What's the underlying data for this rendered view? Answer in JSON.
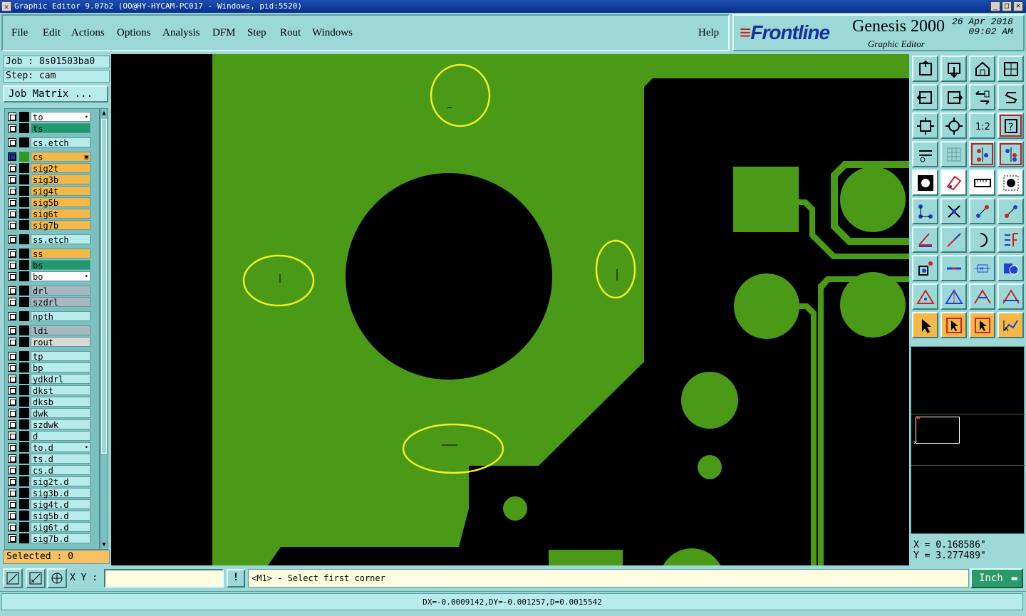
{
  "window": {
    "title": "Graphic Editor 9.07b2 (OO@HY-HYCAM-PC017 - Windows, pid:5520)"
  },
  "menu": {
    "items": [
      "File",
      "Edit",
      "Actions",
      "Options",
      "Analysis",
      "DFM",
      "Step",
      "Rout",
      "Windows"
    ],
    "help": "Help"
  },
  "brand": {
    "logo": "Frontline",
    "product": "Genesis 2000",
    "date_line1": "26 Apr 2018",
    "date_line2": "09:02 AM",
    "subtitle": "Graphic Editor"
  },
  "job": {
    "job_text": "Job : 8s01503ba0",
    "step_text": "Step: cam",
    "matrix_button": "Job Matrix ..."
  },
  "layers": [
    {
      "name": "to",
      "color": "#ffffff",
      "swatch": "#000000",
      "mark": "•"
    },
    {
      "name": "ts",
      "color": "#1f9a6c",
      "swatch": "#000000",
      "mark": ""
    },
    {
      "name": "cs.etch",
      "color": "#b8ecec",
      "swatch": "#000000",
      "mark": ""
    },
    {
      "name": "cs",
      "color": "#f4b848",
      "swatch": "#2e9a1e",
      "mark": "▣",
      "active": true
    },
    {
      "name": "sig2t",
      "color": "#f4b848",
      "swatch": "#000000",
      "mark": ""
    },
    {
      "name": "sig3b",
      "color": "#f4b848",
      "swatch": "#000000",
      "mark": ""
    },
    {
      "name": "sig4t",
      "color": "#f4b848",
      "swatch": "#000000",
      "mark": ""
    },
    {
      "name": "sig5b",
      "color": "#f4b848",
      "swatch": "#000000",
      "mark": ""
    },
    {
      "name": "sig6t",
      "color": "#f4b848",
      "swatch": "#000000",
      "mark": ""
    },
    {
      "name": "sig7b",
      "color": "#f4b848",
      "swatch": "#000000",
      "mark": ""
    },
    {
      "name": "ss.etch",
      "color": "#b8ecec",
      "swatch": "#000000",
      "mark": ""
    },
    {
      "name": "ss",
      "color": "#f4b848",
      "swatch": "#000000",
      "mark": ""
    },
    {
      "name": "bs",
      "color": "#1f9a6c",
      "swatch": "#000000",
      "mark": ""
    },
    {
      "name": "bo",
      "color": "#ffffff",
      "swatch": "#000000",
      "mark": "•"
    },
    {
      "name": "drl",
      "color": "#a8b8c0",
      "swatch": "#000000",
      "mark": ""
    },
    {
      "name": "szdrl",
      "color": "#a8b8c0",
      "swatch": "#000000",
      "mark": ""
    },
    {
      "name": "npth",
      "color": "#b8ecec",
      "swatch": "#000000",
      "mark": ""
    },
    {
      "name": "ldi",
      "color": "#a8b8c0",
      "swatch": "#000000",
      "mark": ""
    },
    {
      "name": "rout",
      "color": "#d8d8d8",
      "swatch": "#000000",
      "mark": ""
    },
    {
      "name": "tp",
      "color": "#b8ecec",
      "swatch": "#000000",
      "mark": ""
    },
    {
      "name": "bp",
      "color": "#b8ecec",
      "swatch": "#000000",
      "mark": ""
    },
    {
      "name": "ydkdrl",
      "color": "#b8ecec",
      "swatch": "#000000",
      "mark": ""
    },
    {
      "name": "dkst",
      "color": "#b8ecec",
      "swatch": "#000000",
      "mark": ""
    },
    {
      "name": "dksb",
      "color": "#b8ecec",
      "swatch": "#000000",
      "mark": ""
    },
    {
      "name": "dwk",
      "color": "#b8ecec",
      "swatch": "#000000",
      "mark": ""
    },
    {
      "name": "szdwk",
      "color": "#b8ecec",
      "swatch": "#000000",
      "mark": ""
    },
    {
      "name": "d",
      "color": "#b8ecec",
      "swatch": "#000000",
      "mark": ""
    },
    {
      "name": "to.d",
      "color": "#b8ecec",
      "swatch": "#000000",
      "mark": "•"
    },
    {
      "name": "ts.d",
      "color": "#b8ecec",
      "swatch": "#000000",
      "mark": ""
    },
    {
      "name": "cs.d",
      "color": "#b8ecec",
      "swatch": "#000000",
      "mark": ""
    },
    {
      "name": "sig2t.d",
      "color": "#b8ecec",
      "swatch": "#000000",
      "mark": ""
    },
    {
      "name": "sig3b.d",
      "color": "#b8ecec",
      "swatch": "#000000",
      "mark": ""
    },
    {
      "name": "sig4t.d",
      "color": "#b8ecec",
      "swatch": "#000000",
      "mark": ""
    },
    {
      "name": "sig5b.d",
      "color": "#b8ecec",
      "swatch": "#000000",
      "mark": ""
    },
    {
      "name": "sig6t.d",
      "color": "#b8ecec",
      "swatch": "#000000",
      "mark": ""
    },
    {
      "name": "sig7b.d",
      "color": "#b8ecec",
      "swatch": "#000000",
      "mark": ""
    }
  ],
  "selected": {
    "text": "Selected : 0"
  },
  "coords": {
    "x": "X = 0.168586\"",
    "y": "Y = 3.277489\""
  },
  "command": {
    "xy_label": "X Y :",
    "xy_value": "",
    "excl": "!",
    "prompt": "<M1> - Select first corner",
    "unit": "Inch"
  },
  "status": {
    "text": "DX=-0.0009142,DY=-0.001257,D=0.0015542"
  },
  "colors": {
    "copper": "#4a9a18",
    "highlight": "#f0f020",
    "accent_orange": "#f4b848"
  }
}
